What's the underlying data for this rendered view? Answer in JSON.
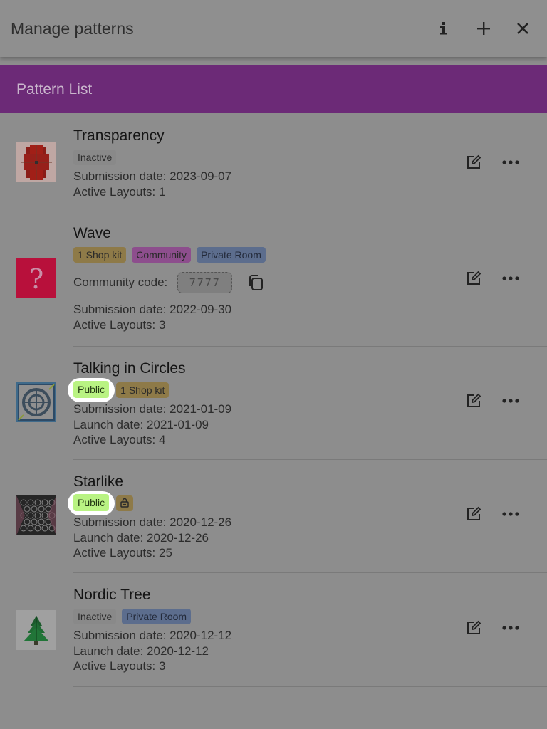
{
  "header": {
    "title": "Manage patterns",
    "icons": [
      "info-icon",
      "plus-icon",
      "close-icon"
    ]
  },
  "section": {
    "title": "Pattern List"
  },
  "patterns": [
    {
      "name": "Transparency",
      "tags": [
        "Inactive"
      ],
      "submission": "Submission date: 2023-09-07",
      "layouts": "Active Layouts: 1"
    },
    {
      "name": "Wave",
      "tags": [
        "1 Shop kit",
        "Community",
        "Private Room"
      ],
      "community_label": "Community code:",
      "community_code": "7777",
      "submission": "Submission date: 2022-09-30",
      "layouts": "Active Layouts: 3"
    },
    {
      "name": "Talking in Circles",
      "tags": [
        "Public",
        "1 Shop kit"
      ],
      "submission": "Submission date: 2021-01-09",
      "launch": "Launch date: 2021-01-09",
      "layouts": "Active Layouts: 4"
    },
    {
      "name": "Starlike",
      "tags": [
        "Public"
      ],
      "tag_icons": [
        "lock-icon"
      ],
      "submission": "Submission date: 2020-12-26",
      "launch": "Launch date: 2020-12-26",
      "layouts": "Active Layouts: 25"
    },
    {
      "name": "Nordic Tree",
      "tags": [
        "Inactive",
        "Private Room"
      ],
      "submission": "Submission date: 2020-12-12",
      "launch": "Launch date: 2020-12-12",
      "layouts": "Active Layouts: 3"
    }
  ],
  "colors": {
    "section_bar": "#6c2a77",
    "public_tag": "#b9f383",
    "highlight": "#ffffff"
  }
}
